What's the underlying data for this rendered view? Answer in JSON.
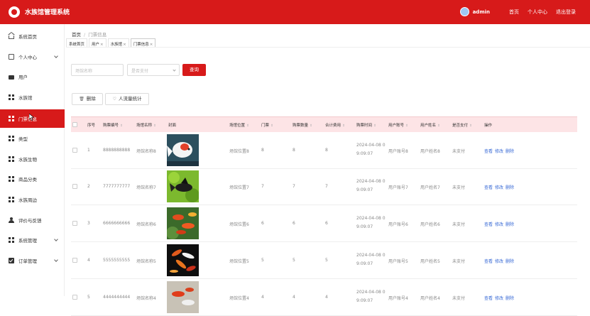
{
  "app": {
    "title": "水族馆管理系统"
  },
  "topbar": {
    "user": "admin",
    "links": [
      "首页",
      "个人中心",
      "退出登录"
    ]
  },
  "sidebar": {
    "items": [
      {
        "label": "系统首页",
        "icon": "home-icon"
      },
      {
        "label": "个人中心",
        "icon": "window-icon",
        "expandable": true
      },
      {
        "label": "用户",
        "icon": "briefcase-icon"
      },
      {
        "label": "水族馆",
        "icon": "grid-icon"
      },
      {
        "label": "门票信息",
        "icon": "grid-icon",
        "active": true
      },
      {
        "label": "类型",
        "icon": "grid-icon"
      },
      {
        "label": "水族生物",
        "icon": "grid-icon"
      },
      {
        "label": "商品分类",
        "icon": "grid-icon"
      },
      {
        "label": "水族周边",
        "icon": "grid-icon"
      },
      {
        "label": "评价与反馈",
        "icon": "person-icon"
      },
      {
        "label": "系统管理",
        "icon": "grid-icon",
        "expandable": true
      },
      {
        "label": "订单管理",
        "icon": "check-icon",
        "expandable": true
      }
    ]
  },
  "breadcrumb": {
    "home": "首页",
    "separator": "/",
    "current": "门票信息"
  },
  "tabs": [
    {
      "label": "系统首页",
      "closable": false
    },
    {
      "label": "用户",
      "closable": true
    },
    {
      "label": "水族馆",
      "closable": true
    },
    {
      "label": "门票信息",
      "closable": true,
      "active": true
    }
  ],
  "search": {
    "name_placeholder": "场馆名称",
    "paid_placeholder": "是否支付",
    "search_button": "查询"
  },
  "actions": {
    "delete": "删除",
    "stats": "人流量统计"
  },
  "table": {
    "columns": [
      "序号",
      "购票编号",
      "场馆名称",
      "封面",
      "场馆位置",
      "门票",
      "购票数量",
      "合计费用",
      "购票时间",
      "用户账号",
      "用户姓名",
      "是否支付",
      "操作"
    ],
    "rows": [
      {
        "no": "1",
        "ticket_id": "8888888888",
        "venue": "场馆名称8",
        "location": "场馆位置8",
        "price": "8",
        "qty": "8",
        "total": "8",
        "time1": "2024-04-08 0",
        "time2": "9:09:07",
        "account": "用户账号8",
        "name": "用户姓名8",
        "paid": "未支付"
      },
      {
        "no": "2",
        "ticket_id": "7777777777",
        "venue": "场馆名称7",
        "location": "场馆位置7",
        "price": "7",
        "qty": "7",
        "total": "7",
        "time1": "2024-04-08 0",
        "time2": "9:09:07",
        "account": "用户账号7",
        "name": "用户姓名7",
        "paid": "未支付"
      },
      {
        "no": "3",
        "ticket_id": "6666666666",
        "venue": "场馆名称6",
        "location": "场馆位置6",
        "price": "6",
        "qty": "6",
        "total": "6",
        "time1": "2024-04-08 0",
        "time2": "9:09:07",
        "account": "用户账号6",
        "name": "用户姓名6",
        "paid": "未支付"
      },
      {
        "no": "4",
        "ticket_id": "5555555555",
        "venue": "场馆名称5",
        "location": "场馆位置5",
        "price": "5",
        "qty": "5",
        "total": "5",
        "time1": "2024-04-08 0",
        "time2": "9:09:07",
        "account": "用户账号5",
        "name": "用户姓名5",
        "paid": "未支付"
      },
      {
        "no": "5",
        "ticket_id": "4444444444",
        "venue": "场馆名称4",
        "location": "场馆位置4",
        "price": "4",
        "qty": "4",
        "total": "4",
        "time1": "2024-04-08 0",
        "time2": "9:09:07",
        "account": "用户账号4",
        "name": "用户姓名4",
        "paid": "未支付"
      }
    ],
    "ops": [
      "查看",
      "修改",
      "删除"
    ]
  },
  "colors": {
    "brand": "#d71a1a",
    "header_bg": "#fde4e6",
    "link": "#3a6bd6"
  }
}
